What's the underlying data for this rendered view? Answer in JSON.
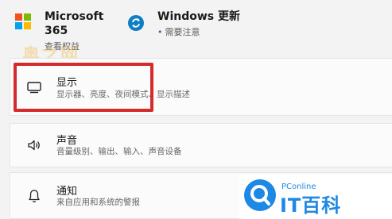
{
  "top": {
    "ms365": {
      "title": "Microsoft 365",
      "subtitle": "查看权益"
    },
    "windows_update": {
      "title": "Windows 更新",
      "subtitle": "需要注意",
      "dot": "•"
    }
  },
  "watermark": "奥之网",
  "settings_items": [
    {
      "icon": "monitor-icon",
      "title": "显示",
      "subtitle": "显示器、亮度、夜间模式、显示描述"
    },
    {
      "icon": "speaker-icon",
      "title": "声音",
      "subtitle": "音量级别、输出、输入、声音设备"
    },
    {
      "icon": "bell-icon",
      "title": "通知",
      "subtitle": "来自应用和系统的警报"
    }
  ],
  "logo": {
    "brand_small": "PConline",
    "brand_big": "IT百科"
  },
  "colors": {
    "highlight": "#d42b2b",
    "brand_blue": "#1e88e5",
    "accent_blue": "#0f7fc4"
  }
}
